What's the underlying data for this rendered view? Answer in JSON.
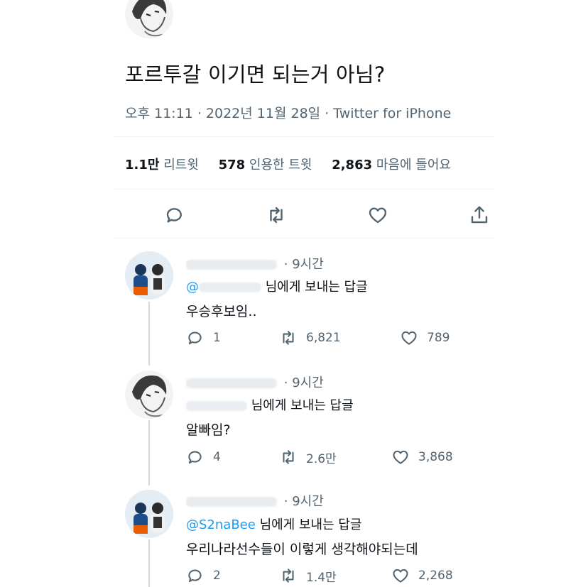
{
  "main_tweet": {
    "text": "포르투갈 이기면 되는거 아님?",
    "time": "오후 11:11",
    "date": "2022년 11월 28일",
    "source": "Twitter for iPhone",
    "stats": {
      "retweets_value": "1.1만",
      "retweets_label": "리트윗",
      "quotes_value": "578",
      "quotes_label": "인용한 트윗",
      "likes_value": "2,863",
      "likes_label": "마음에 들어요"
    }
  },
  "replies": [
    {
      "time": "9시간",
      "mention": "@",
      "replying_suffix": "님에게 보내는 답글",
      "text": "우승후보임..",
      "reply_count": "1",
      "retweet_count": "6,821",
      "like_count": "789"
    },
    {
      "time": "9시간",
      "mention": "",
      "replying_suffix": "님에게 보내는 답글",
      "text": "알빠임?",
      "reply_count": "4",
      "retweet_count": "2.6만",
      "like_count": "3,868"
    },
    {
      "time": "9시간",
      "mention": "@S2naBee",
      "replying_suffix": "님에게 보내는 답글",
      "text": "우리나라선수들이 이렇게 생각해야되는데",
      "reply_count": "2",
      "retweet_count": "1.4만",
      "like_count": "2,268"
    }
  ],
  "icons": [
    "reply-icon",
    "retweet-icon",
    "like-icon",
    "share-icon"
  ],
  "colors": {
    "text": "#0f1419",
    "secondary": "#536471",
    "link": "#1d9bf0",
    "divider": "#eff3f4"
  }
}
